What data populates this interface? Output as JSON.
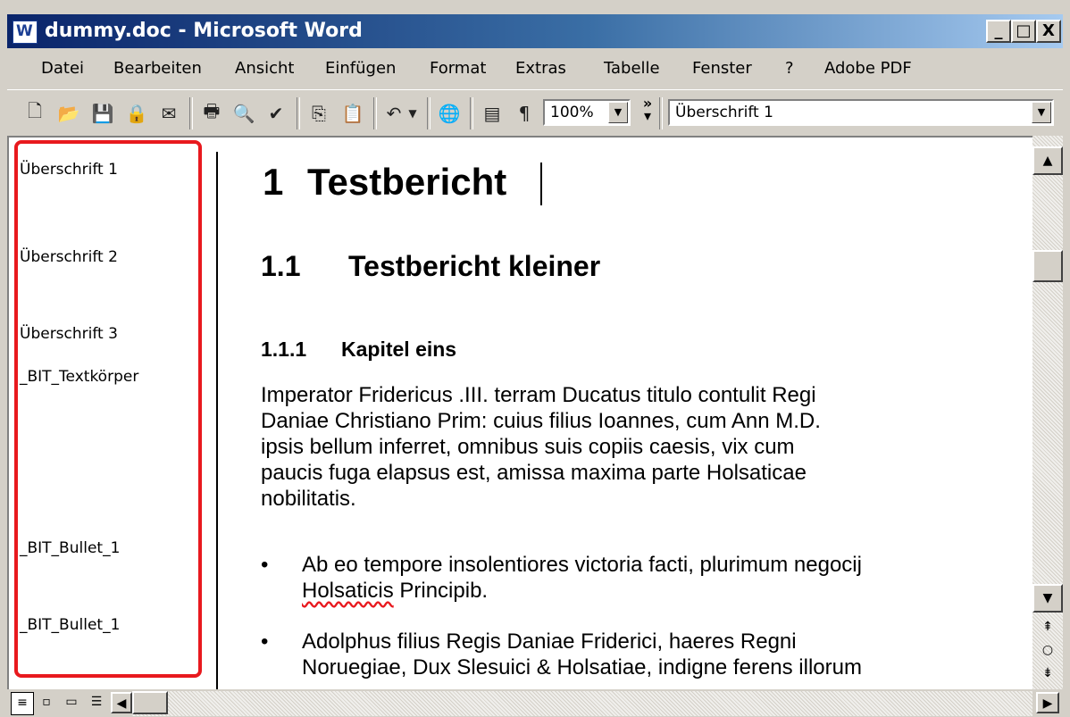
{
  "window": {
    "title": "dummy.doc - Microsoft Word"
  },
  "caption_buttons": {
    "minimize": "_",
    "maximize": "□",
    "close": "X"
  },
  "menu": {
    "items": [
      "Datei",
      "Bearbeiten",
      "Ansicht",
      "Einfügen",
      "Format",
      "Extras",
      "Tabelle",
      "Fenster",
      "?",
      "Adobe PDF"
    ]
  },
  "toolbar": {
    "buttons": [
      "new-icon",
      "open-icon",
      "save-icon",
      "permission-icon",
      "email-icon",
      "print-icon",
      "print-preview-icon",
      "spelling-icon",
      "copy-icon",
      "paste-icon",
      "undo-icon",
      "hyperlink-icon",
      "document-map-icon",
      "show-formatting-icon"
    ],
    "zoom": "100%",
    "style": "Überschrift 1"
  },
  "style_area": {
    "labels": [
      "Überschrift 1",
      "Überschrift 2",
      "Überschrift 3",
      "_BIT_Textkörper",
      "_BIT_Bullet_1",
      "_BIT_Bullet_1"
    ]
  },
  "document": {
    "h1": {
      "num": "1",
      "text": "Testbericht"
    },
    "h2": {
      "num": "1.1",
      "text": "Testbericht kleiner"
    },
    "h3": {
      "num": "1.1.1",
      "text": "Kapitel eins"
    },
    "paragraph_lines": [
      "Imperator Fridericus .III. terram Ducatus titulo contulit Regi",
      "Daniae Christiano Prim: cuius filius Ioannes, cum Ann M.D.",
      "ipsis bellum inferret, omnibus suis copiis caesis, vix cum",
      "paucis fuga elapsus est, amissa maxima parte Holsaticae",
      "nobilitatis."
    ],
    "bullet1": {
      "line1": "Ab eo tempore insolentiores victoria facti, plurimum negocij",
      "line2_word": "Holsaticis",
      "line2_rest": " Principib."
    },
    "bullet2": {
      "line1": "Adolphus filius Regis Daniae Friderici, haeres Regni",
      "line2": "Noruegiae, Dux Slesuici & Holsatiae, indigne ferens illorum"
    }
  },
  "colors": {
    "title_bar_start": "#0a246a",
    "title_bar_end": "#a6caf0",
    "style_area_border": "#e8191e"
  }
}
